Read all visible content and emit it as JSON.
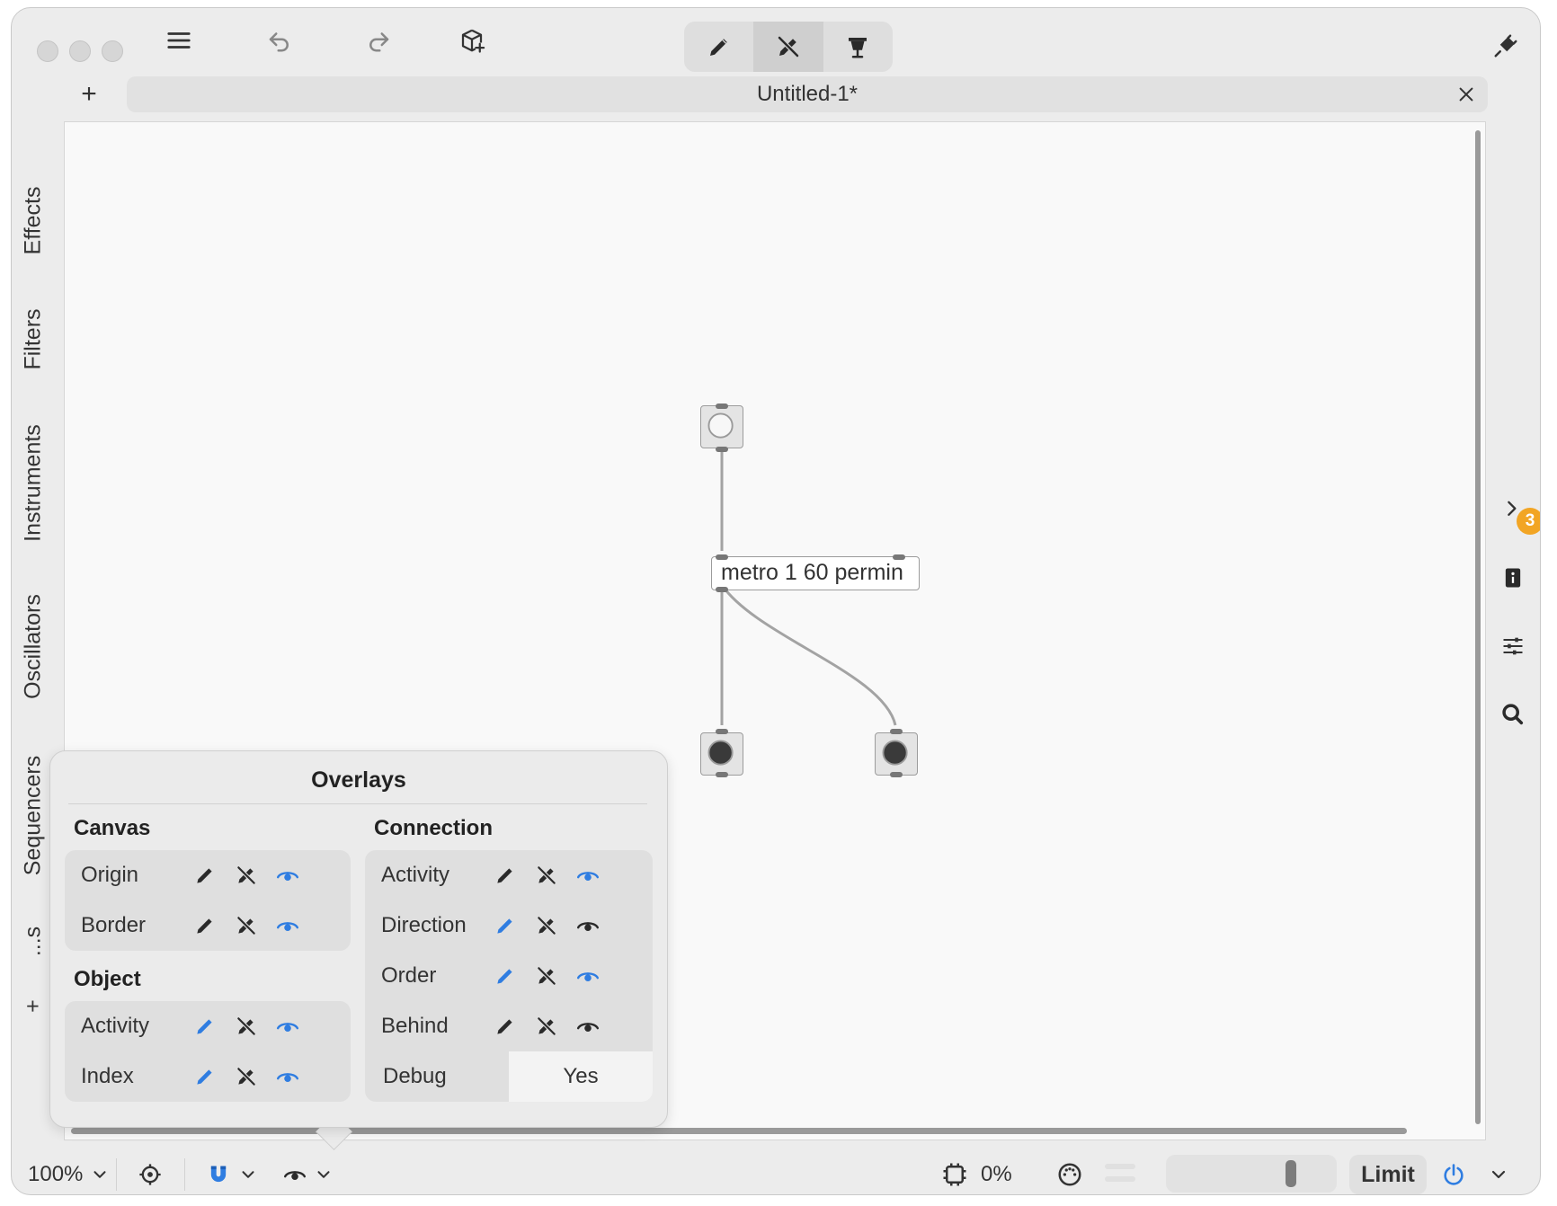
{
  "window": {
    "tab_title": "Untitled-1*",
    "new_tab_label": "+"
  },
  "toolbar": {
    "icons": [
      "menu-icon",
      "undo-icon",
      "redo-icon",
      "add-object-icon",
      "edit-mode-icon",
      "run-mode-icon",
      "presentation-mode-icon",
      "plugin-icon"
    ]
  },
  "sidebar": {
    "tabs": [
      "Effects",
      "Filters",
      "Instruments",
      "Oscillators",
      "Sequencers",
      "...s",
      "+"
    ]
  },
  "canvas": {
    "metro_object": "metro 1 60 permin"
  },
  "right_panel": {
    "badge_count": "3",
    "icons": [
      "expand-chevron-icon",
      "documentation-icon",
      "settings-sliders-icon",
      "search-icon"
    ]
  },
  "overlays": {
    "title": "Overlays",
    "canvas_header": "Canvas",
    "object_header": "Object",
    "connection_header": "Connection",
    "canvas_rows": [
      {
        "label": "Origin",
        "edit_on": false,
        "run_on": false,
        "view_on": true
      },
      {
        "label": "Border",
        "edit_on": false,
        "run_on": false,
        "view_on": true
      }
    ],
    "object_rows": [
      {
        "label": "Activity",
        "edit_on": true,
        "run_on": false,
        "view_on": true
      },
      {
        "label": "Index",
        "edit_on": true,
        "run_on": false,
        "view_on": true
      }
    ],
    "connection_rows": [
      {
        "label": "Activity",
        "edit_on": false,
        "run_on": false,
        "view_on": true
      },
      {
        "label": "Direction",
        "edit_on": true,
        "run_on": false,
        "view_on": false
      },
      {
        "label": "Order",
        "edit_on": true,
        "run_on": false,
        "view_on": true
      },
      {
        "label": "Behind",
        "edit_on": false,
        "run_on": false,
        "view_on": false
      }
    ],
    "debug_label": "Debug",
    "debug_value": "Yes"
  },
  "bottom_bar": {
    "zoom": "100%",
    "cpu_percent": "0%",
    "limit_label": "Limit",
    "volume_level": 0.77
  },
  "colors": {
    "accent_blue": "#2f7de1",
    "icon_dark": "#2a2a2a",
    "badge_orange": "#f2a524"
  }
}
